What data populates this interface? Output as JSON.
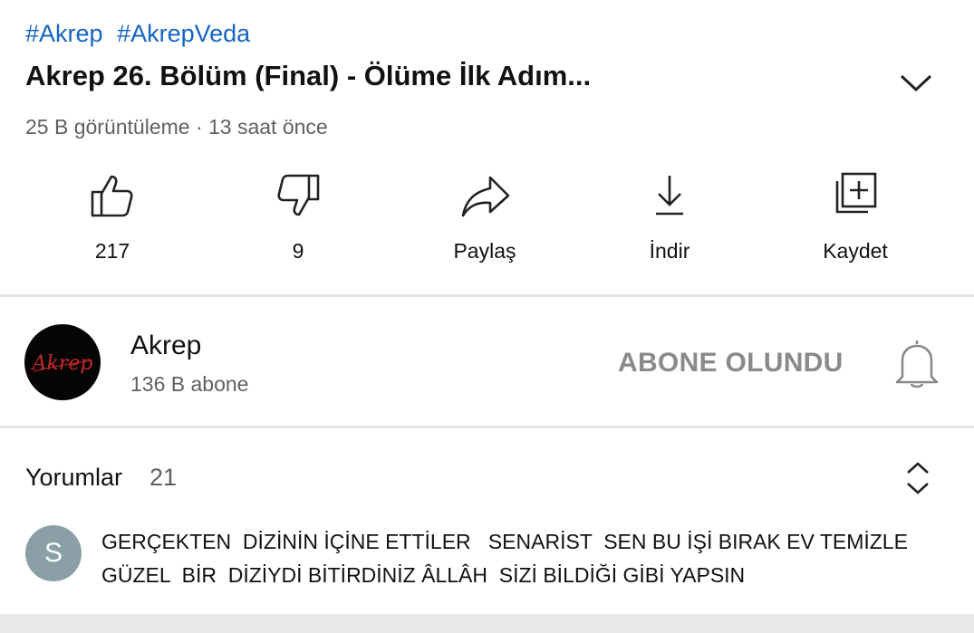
{
  "video": {
    "hashtags": [
      "#Akrep",
      "#AkrepVeda"
    ],
    "title": "Akrep 26. Bölüm (Final) - Ölüme İlk Adım...",
    "meta": "25 B görüntüleme · 13 saat önce"
  },
  "actions": {
    "like_count": "217",
    "dislike_count": "9",
    "share_label": "Paylaş",
    "download_label": "İndir",
    "save_label": "Kaydet"
  },
  "channel": {
    "avatar_text": "Akrep",
    "name": "Akrep",
    "subscribers": "136 B abone",
    "subscribed_label": "ABONE OLUNDU"
  },
  "comments": {
    "title": "Yorumlar",
    "count": "21",
    "first": {
      "avatar_letter": "S",
      "text": "GERÇEKTEN  DİZİNİN İÇİNE ETTİLER   SENARİST  SEN BU İŞİ BIRAK EV TEMİZLE GÜZEL  BİR  DİZİYDİ BİTİRDİNİZ ÂLLÂH  SİZİ BİLDİĞİ GİBİ YAPSIN"
    }
  },
  "colors": {
    "hashtag": "#1565c0",
    "secondary_text": "#606060",
    "subscribed_text": "#8a8a8a",
    "logo_red": "#c62828",
    "comment_avatar": "#8a9fa6"
  },
  "icons": [
    "chevron-down-icon",
    "thumbs-up-icon",
    "thumbs-down-icon",
    "share-icon",
    "download-icon",
    "add-to-playlist-icon",
    "bell-icon",
    "sort-icon"
  ]
}
